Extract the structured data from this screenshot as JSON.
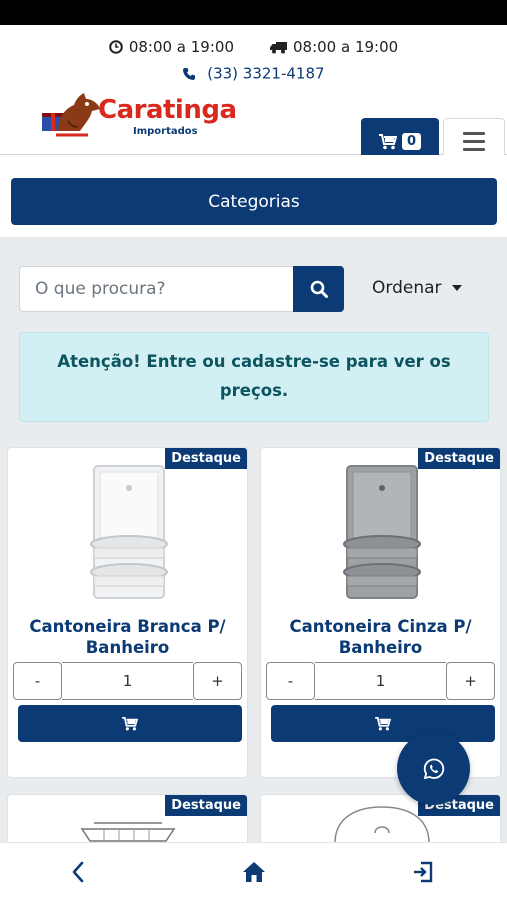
{
  "header": {
    "store_hours": "08:00 a 19:00",
    "delivery_hours": "08:00 a 19:00",
    "phone": "(33) 3321-4187",
    "logo_name": "Caratinga",
    "logo_sub": "Importados",
    "cart_count": "0"
  },
  "categories_button": "Categorias",
  "search": {
    "placeholder": "O que procura?"
  },
  "sort_label": "Ordenar",
  "alert_text": "Atenção! Entre ou cadastre-se para ver os preços.",
  "products": [
    {
      "badge": "Destaque",
      "name": "Cantoneira Branca P/ Banheiro",
      "qty": "1",
      "minus": "-",
      "plus": "+"
    },
    {
      "badge": "Destaque",
      "name": "Cantoneira Cinza P/ Banheiro",
      "qty": "1",
      "minus": "-",
      "plus": "+"
    },
    {
      "badge": "Destaque"
    },
    {
      "badge": "Destaque"
    }
  ],
  "colors": {
    "primary": "#0b3a74",
    "brand_red": "#d9281e",
    "alert_bg": "#d2eff3"
  },
  "icons": [
    "clock-icon",
    "truck-icon",
    "phone-icon",
    "cart-icon",
    "hamburger-icon",
    "search-icon",
    "whatsapp-icon",
    "back-icon",
    "home-icon",
    "logout-icon"
  ]
}
